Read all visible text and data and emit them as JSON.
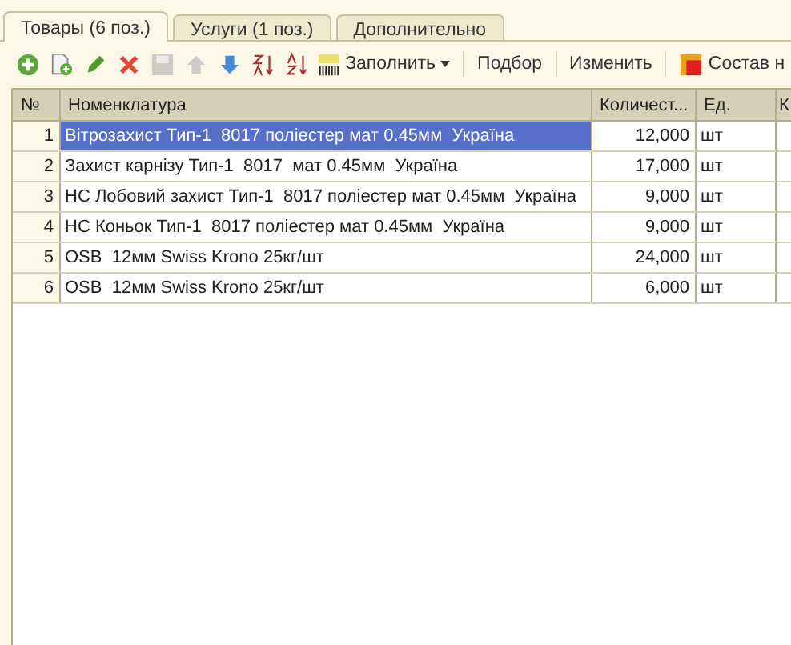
{
  "tabs": [
    {
      "label": "Товары (6 поз.)",
      "selected": true
    },
    {
      "label": "Услуги (1 поз.)",
      "selected": false
    },
    {
      "label": "Дополнительно",
      "selected": false
    }
  ],
  "toolbar": [
    {
      "kind": "add",
      "disabled": false
    },
    {
      "kind": "copy",
      "disabled": false
    },
    {
      "kind": "edit",
      "disabled": false
    },
    {
      "kind": "delete",
      "disabled": false
    },
    {
      "kind": "save",
      "disabled": true
    },
    {
      "kind": "up",
      "disabled": true
    },
    {
      "kind": "down",
      "disabled": false
    },
    {
      "kind": "sort-asc",
      "disabled": false
    },
    {
      "kind": "sort-desc",
      "disabled": false
    },
    {
      "kind": "fill",
      "label": "Заполнить",
      "dropdown": true
    },
    {
      "kind": "text",
      "label": "Подбор"
    },
    {
      "kind": "text",
      "label": "Изменить"
    },
    {
      "kind": "composition",
      "label": "Состав н"
    }
  ],
  "table": {
    "columns": [
      "№",
      "Номенклатура",
      "Количест...",
      "Ед.",
      "К"
    ],
    "rows": [
      {
        "n": "1",
        "name": "Вітрозахист Тип-1  8017 поліестер мат 0.45мм  Україна",
        "qty": "12,000",
        "unit": "шт",
        "selected": true
      },
      {
        "n": "2",
        "name": "Захист карнізу Тип-1  8017  мат 0.45мм  Україна",
        "qty": "17,000",
        "unit": "шт",
        "selected": false
      },
      {
        "n": "3",
        "name": "НС Лобовий захист Тип-1  8017 поліестер мат 0.45мм  Україна",
        "qty": "9,000",
        "unit": "шт",
        "selected": false
      },
      {
        "n": "4",
        "name": "НС Коньок Тип-1  8017 поліестер мат 0.45мм  Україна",
        "qty": "9,000",
        "unit": "шт",
        "selected": false
      },
      {
        "n": "5",
        "name": "OSB  12мм Swiss Krono 25кг/шт",
        "qty": "24,000",
        "unit": "шт",
        "selected": false
      },
      {
        "n": "6",
        "name": "OSB  12мм Swiss Krono 25кг/шт",
        "qty": "6,000",
        "unit": "шт",
        "selected": false
      }
    ]
  }
}
